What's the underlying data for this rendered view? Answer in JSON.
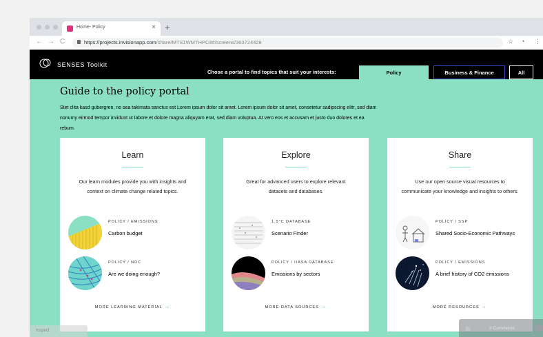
{
  "browser": {
    "tab_title": "Home- Policy",
    "tab_close": "×",
    "new_tab": "+",
    "url_main": "https://projects.invisionapp.com",
    "url_rest": "/share/MTS1WMTHPC9#/screens/363724428",
    "back": "←",
    "forward": "→",
    "reload": "C"
  },
  "header": {
    "logo_text": "SENSES Toolkit",
    "portal_prompt": "Chose a portal to find topics that suit your interests:",
    "tabs": [
      "Policy",
      "Business & Finance",
      "All"
    ]
  },
  "guide": {
    "title": "Guide to the policy portal",
    "body": "Stet clita kasd gubergren, no sea takimata sanctus est Lorem ipsum dolor sit amet. Lorem ipsum dolor sit amet, consetetur sadipscing elitr, sed diam nonumy eirmod tempor invidunt ut labore et dolore magna aliquyam erat, sed diam voluptua. At vero eos et accusam et justo duo dolores et ea rebum."
  },
  "cards": [
    {
      "title": "Learn",
      "description": "Our learn modules provide you with insights and context on climate change related topics.",
      "items": [
        {
          "category": "POLICY / EMISSIONS",
          "title": "Carbon budget"
        },
        {
          "category": "POLICY / NDC",
          "title": "Are we doing enough?"
        }
      ],
      "more": "MORE LEARNING MATERIAL"
    },
    {
      "title": "Explore",
      "description": "Great for advanced users to explore relevant datasets and databases.",
      "items": [
        {
          "category": "1.5°C DATABASE",
          "title": "Scenario Finder"
        },
        {
          "category": "POLICY / IIASA DATABASE",
          "title": "Emissions by sectors"
        }
      ],
      "more": "MORE DATA SOURCES"
    },
    {
      "title": "Share",
      "description": "Use our open source visual resources to communicate your knowledge and insights to others.",
      "items": [
        {
          "category": "POLICY / SSP",
          "title": "Shared Socio-Economic Pathways"
        },
        {
          "category": "POLICY / EMISSIONS",
          "title": "A brief history of CO2 emissions"
        }
      ],
      "more": "MORE RESOURCES"
    }
  ],
  "more_arrow": "→",
  "overlay": {
    "left_label": "Inspect",
    "comments": "0 Comments"
  },
  "colors": {
    "mint": "#8be0c4",
    "header": "#000000",
    "business_border": "#3e4ad2",
    "arrow": "#3bb88b"
  }
}
